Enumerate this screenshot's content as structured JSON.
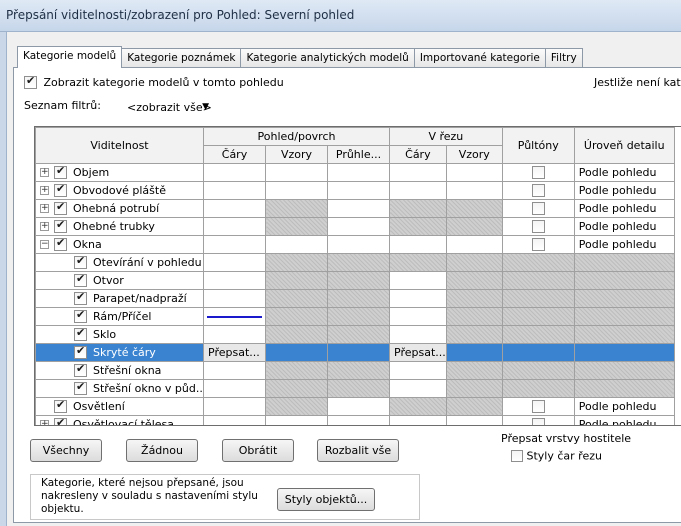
{
  "window": {
    "title": "Přepsání viditelnosti/zobrazení pro Pohled: Severní pohled"
  },
  "tabs": [
    {
      "label": "Kategorie modelů",
      "active": true
    },
    {
      "label": "Kategorie poznámek",
      "active": false
    },
    {
      "label": "Kategorie analytických modelů",
      "active": false
    },
    {
      "label": "Importované kategorie",
      "active": false
    },
    {
      "label": "Filtry",
      "active": false
    }
  ],
  "options": {
    "show_models_label": "Zobrazit kategorie modelů v tomto pohledu",
    "show_models_checked": true,
    "side_note": "Jestliže není kategori",
    "filter_label": "Seznam filtrů:",
    "filter_value": "<zobrazit vše>"
  },
  "grid": {
    "headers": {
      "visibility": "Viditelnost",
      "projection_group": "Pohled/povrch",
      "cut_group": "V řezu",
      "halftone": "Půltóny",
      "detail": "Úroveň detailu",
      "lines": "Čáry",
      "patterns": "Vzory",
      "transparency": "Průhle...",
      "cut_lines": "Čáry",
      "cut_patterns": "Vzory"
    },
    "rows": [
      {
        "name": "Objem",
        "level": 0,
        "expander": "+",
        "checked": true,
        "detail": "Podle pohledu",
        "halftone_box": true
      },
      {
        "name": "Obvodové pláště",
        "level": 0,
        "expander": "+",
        "checked": true,
        "detail": "Podle pohledu",
        "halftone_box": true
      },
      {
        "name": "Ohebná potrubí",
        "level": 0,
        "expander": "+",
        "checked": true,
        "detail": "Podle pohledu",
        "halftone_box": true
      },
      {
        "name": "Ohebné trubky",
        "level": 0,
        "expander": "+",
        "checked": true,
        "detail": "Podle pohledu",
        "halftone_box": true
      },
      {
        "name": "Okna",
        "level": 0,
        "expander": "−",
        "checked": true,
        "detail": "Podle pohledu",
        "halftone_box": true
      },
      {
        "name": "Otevírání v pohledu",
        "level": 1,
        "checked": true
      },
      {
        "name": "Otvor",
        "level": 1,
        "checked": true
      },
      {
        "name": "Parapet/nadpraží",
        "level": 1,
        "checked": true
      },
      {
        "name": "Rám/Příčel",
        "level": 1,
        "checked": true
      },
      {
        "name": "Sklo",
        "level": 1,
        "checked": true
      },
      {
        "name": "Skryté čáry",
        "level": 1,
        "checked": true,
        "selected": true,
        "override_lines": "Přepsat...",
        "override_cut": "Přepsat..."
      },
      {
        "name": "Střešní okna",
        "level": 1,
        "checked": true
      },
      {
        "name": "Střešní okno v půd...",
        "level": 1,
        "checked": true
      },
      {
        "name": "Osvětlení",
        "level": 0,
        "checked": true,
        "detail": "Podle pohledu",
        "halftone_box": true
      },
      {
        "name": "Osvětlovací tělesa",
        "level": 0,
        "expander": "+",
        "checked": true,
        "detail": "Podle pohledu",
        "halftone_box": true
      }
    ]
  },
  "buttons": {
    "all": "Všechny",
    "none": "Žádnou",
    "invert": "Obrátit",
    "expand_all": "Rozbalit vše",
    "object_styles": "Styly objektů..."
  },
  "host_layers": {
    "label": "Přepsat vrstvy hostitele",
    "cut_line_styles": "Styly čar řezu",
    "cut_line_styles_checked": false
  },
  "info_text": "Kategorie, které nejsou přepsané, jsou nakresleny v souladu s nastaveními stylu objektu."
}
